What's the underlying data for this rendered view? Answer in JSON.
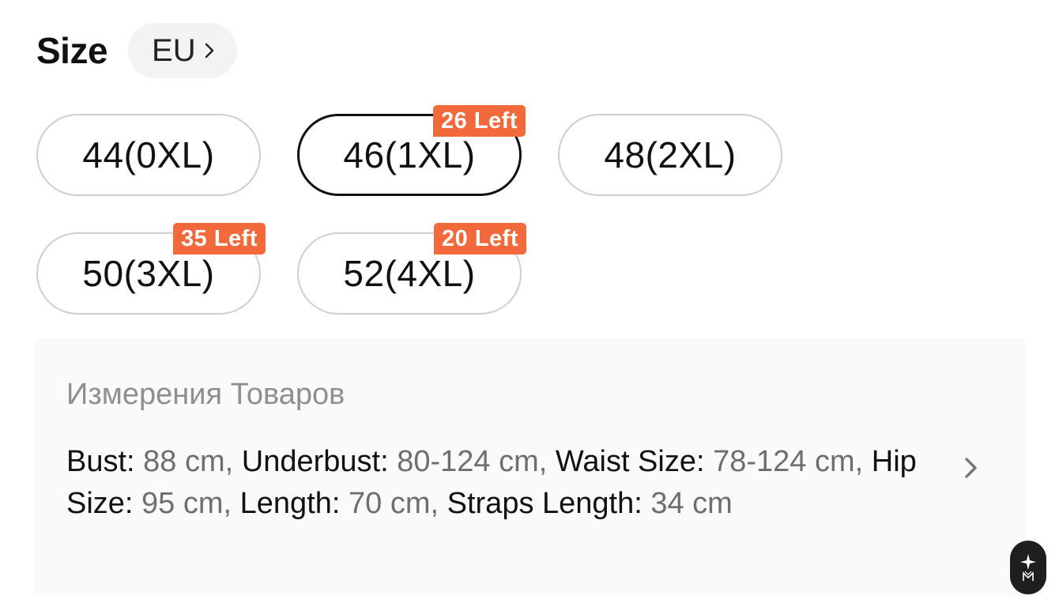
{
  "size_selector": {
    "title": "Size",
    "region_label": "EU"
  },
  "sizes": [
    {
      "label": "44(0XL)",
      "badge": null,
      "selected": false
    },
    {
      "label": "46(1XL)",
      "badge": "26 Left",
      "selected": true
    },
    {
      "label": "48(2XL)",
      "badge": null,
      "selected": false
    },
    {
      "label": "50(3XL)",
      "badge": "35 Left",
      "selected": false
    },
    {
      "label": "52(4XL)",
      "badge": "20 Left",
      "selected": false
    }
  ],
  "measurements": {
    "heading": "Измерения Товаров",
    "items": [
      {
        "key": "Bust:",
        "value": "88 cm"
      },
      {
        "key": "Underbust:",
        "value": "80-124 cm"
      },
      {
        "key": "Waist Size:",
        "value": "78-124 cm"
      },
      {
        "key": "Hip Size:",
        "value": "95 cm"
      },
      {
        "key": "Length:",
        "value": "70 cm"
      },
      {
        "key": "Straps Length:",
        "value": "34 cm"
      }
    ]
  },
  "colors": {
    "badge_bg": "#f26a3c",
    "selected_border": "#111111",
    "default_border": "#cfcfcf",
    "panel_bg": "#fcf9fc"
  },
  "icons": {
    "region_chevron": "chevron-right-icon",
    "measure_chevron": "chevron-right-icon",
    "floating": "assistant-logo-icon"
  }
}
